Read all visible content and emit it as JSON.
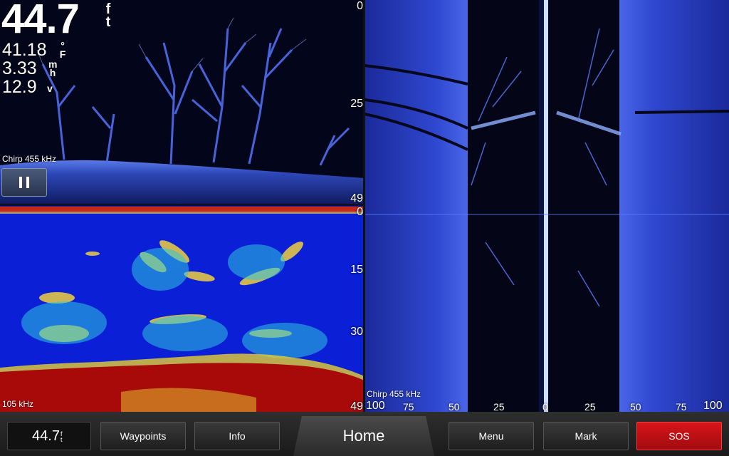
{
  "readouts": {
    "depth": "44.7",
    "depth_unit_1": "f",
    "depth_unit_2": "t",
    "temp": "41.18",
    "temp_unit_1": "°",
    "temp_unit_2": "F",
    "speed": "3.33",
    "speed_unit_1": "m",
    "speed_unit_2": "h",
    "voltage": "12.9",
    "voltage_unit": "v"
  },
  "downvu": {
    "frequency": "Chirp 455 kHz",
    "scale_top": "0",
    "scale_mid": "25",
    "scale_bottom": "49"
  },
  "traditional": {
    "frequency": "105 kHz",
    "scale_top": "0",
    "scale_15": "15",
    "scale_30": "30",
    "scale_bottom": "49"
  },
  "sidevu": {
    "frequency": "Chirp 455 kHz",
    "ticks": [
      "100",
      "75",
      "50",
      "25",
      "0",
      "25",
      "50",
      "75",
      "100"
    ]
  },
  "bottom_bar": {
    "depth_value": "44.7",
    "depth_unit_1": "f",
    "depth_unit_2": "t",
    "waypoints": "Waypoints",
    "info": "Info",
    "home": "Home",
    "menu": "Menu",
    "mark": "Mark",
    "sos": "SOS"
  },
  "colors": {
    "sos_red": "#d8141a",
    "sonar_blue": "#0a1fd6",
    "bottom_red": "#a80a0a"
  }
}
